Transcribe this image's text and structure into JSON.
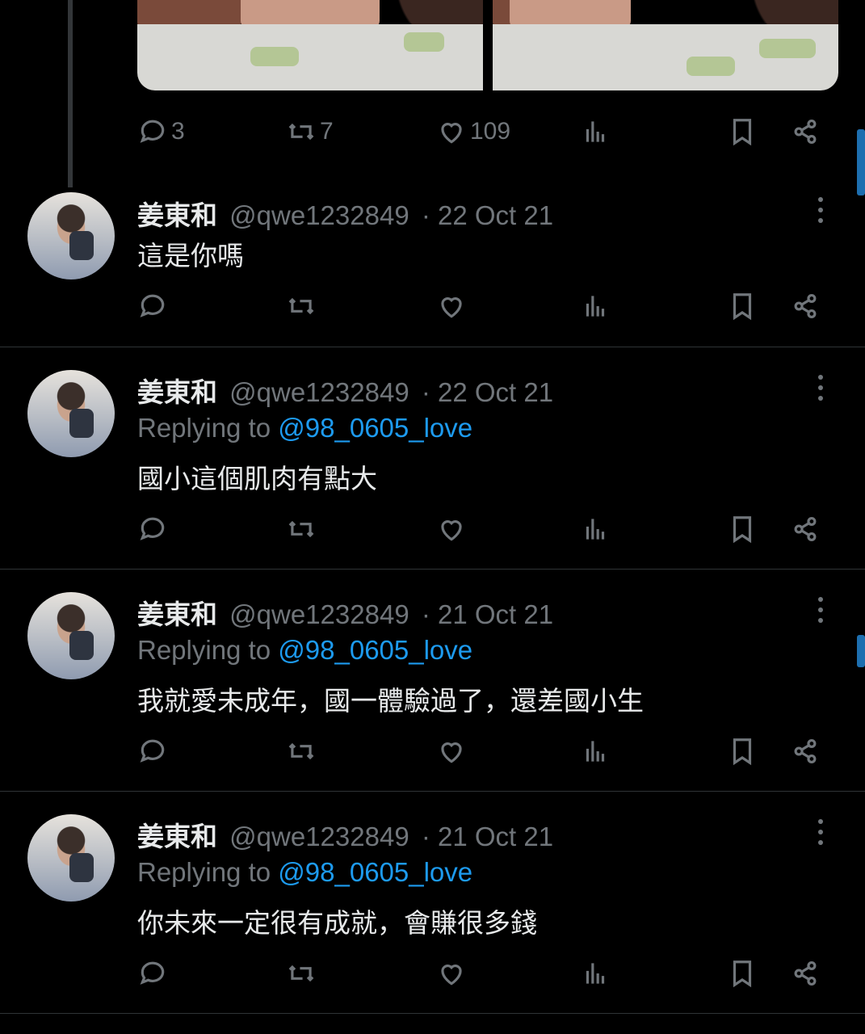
{
  "top_tweet": {
    "stats": {
      "replies": "3",
      "retweets": "7",
      "likes": "109"
    }
  },
  "replies": [
    {
      "name": "姜東和",
      "handle": "@qwe1232849",
      "date": "· 22 Oct 21",
      "replying_label": "",
      "replying_handle": "",
      "text": "這是你嗎"
    },
    {
      "name": "姜東和",
      "handle": "@qwe1232849",
      "date": "· 22 Oct 21",
      "replying_label": "Replying to",
      "replying_handle": "@98_0605_love",
      "text": "國小這個肌肉有點大"
    },
    {
      "name": "姜東和",
      "handle": "@qwe1232849",
      "date": "· 21 Oct 21",
      "replying_label": "Replying to",
      "replying_handle": "@98_0605_love",
      "text": "我就愛未成年，國一體驗過了，還差國小生"
    },
    {
      "name": "姜東和",
      "handle": "@qwe1232849",
      "date": "· 21 Oct 21",
      "replying_label": "Replying to",
      "replying_handle": "@98_0605_love",
      "text": "你未來一定很有成就，會賺很多錢"
    }
  ],
  "icons": [
    "reply-icon",
    "retweet-icon",
    "like-icon",
    "views-icon",
    "bookmark-icon",
    "share-icon",
    "more-icon"
  ],
  "colors": {
    "background": "#000000",
    "text": "#e7e9ea",
    "muted": "#71767b",
    "link": "#1d9bf0",
    "divider": "#2f3336"
  }
}
